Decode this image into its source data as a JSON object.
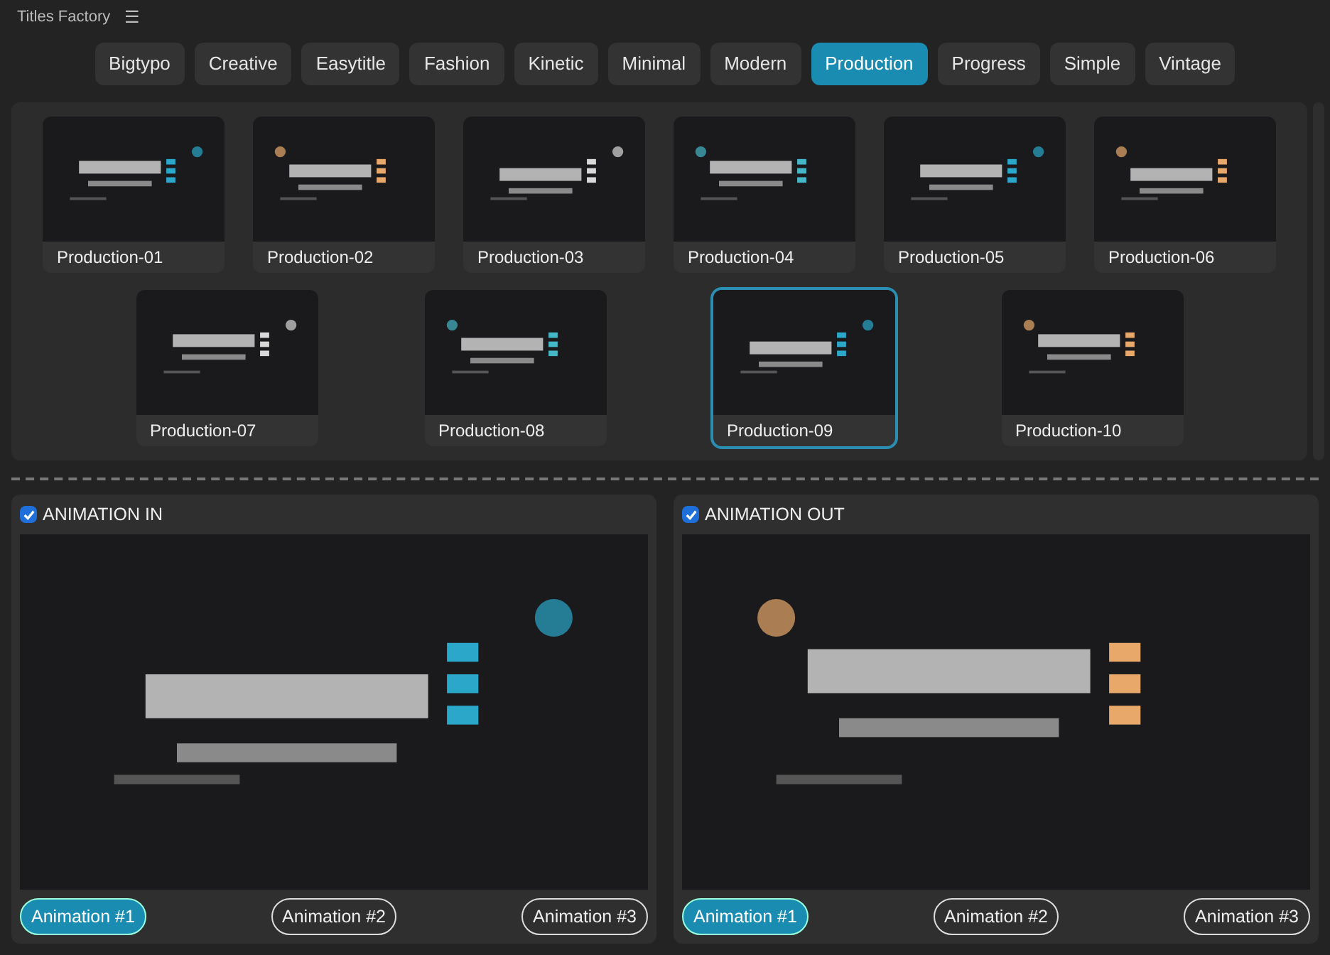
{
  "window": {
    "title": "Titles Factory",
    "menu_glyph": "☰"
  },
  "categories": [
    {
      "label": "Bigtypo",
      "selected": false
    },
    {
      "label": "Creative",
      "selected": false
    },
    {
      "label": "Easytitle",
      "selected": false
    },
    {
      "label": "Fashion",
      "selected": false
    },
    {
      "label": "Kinetic",
      "selected": false
    },
    {
      "label": "Minimal",
      "selected": false
    },
    {
      "label": "Modern",
      "selected": false
    },
    {
      "label": "Production",
      "selected": true
    },
    {
      "label": "Progress",
      "selected": false
    },
    {
      "label": "Simple",
      "selected": false
    },
    {
      "label": "Vintage",
      "selected": false
    }
  ],
  "templates": [
    [
      {
        "label": "Production-01",
        "selected": false
      },
      {
        "label": "Production-02",
        "selected": false
      },
      {
        "label": "Production-03",
        "selected": false
      },
      {
        "label": "Production-04",
        "selected": false
      },
      {
        "label": "Production-05",
        "selected": false
      },
      {
        "label": "Production-06",
        "selected": false
      }
    ],
    [
      {
        "label": "Production-07",
        "selected": false
      },
      {
        "label": "Production-08",
        "selected": false
      },
      {
        "label": "Production-09",
        "selected": true
      },
      {
        "label": "Production-10",
        "selected": false
      }
    ]
  ],
  "animation_panels": [
    {
      "label": "ANIMATION IN",
      "checked": true,
      "presets": [
        {
          "label": "Animation #1",
          "selected": true
        },
        {
          "label": "Animation #2",
          "selected": false
        },
        {
          "label": "Animation #3",
          "selected": false
        }
      ]
    },
    {
      "label": "ANIMATION OUT",
      "checked": true,
      "presets": [
        {
          "label": "Animation #1",
          "selected": true
        },
        {
          "label": "Animation #2",
          "selected": false
        },
        {
          "label": "Animation #3",
          "selected": false
        }
      ]
    }
  ]
}
